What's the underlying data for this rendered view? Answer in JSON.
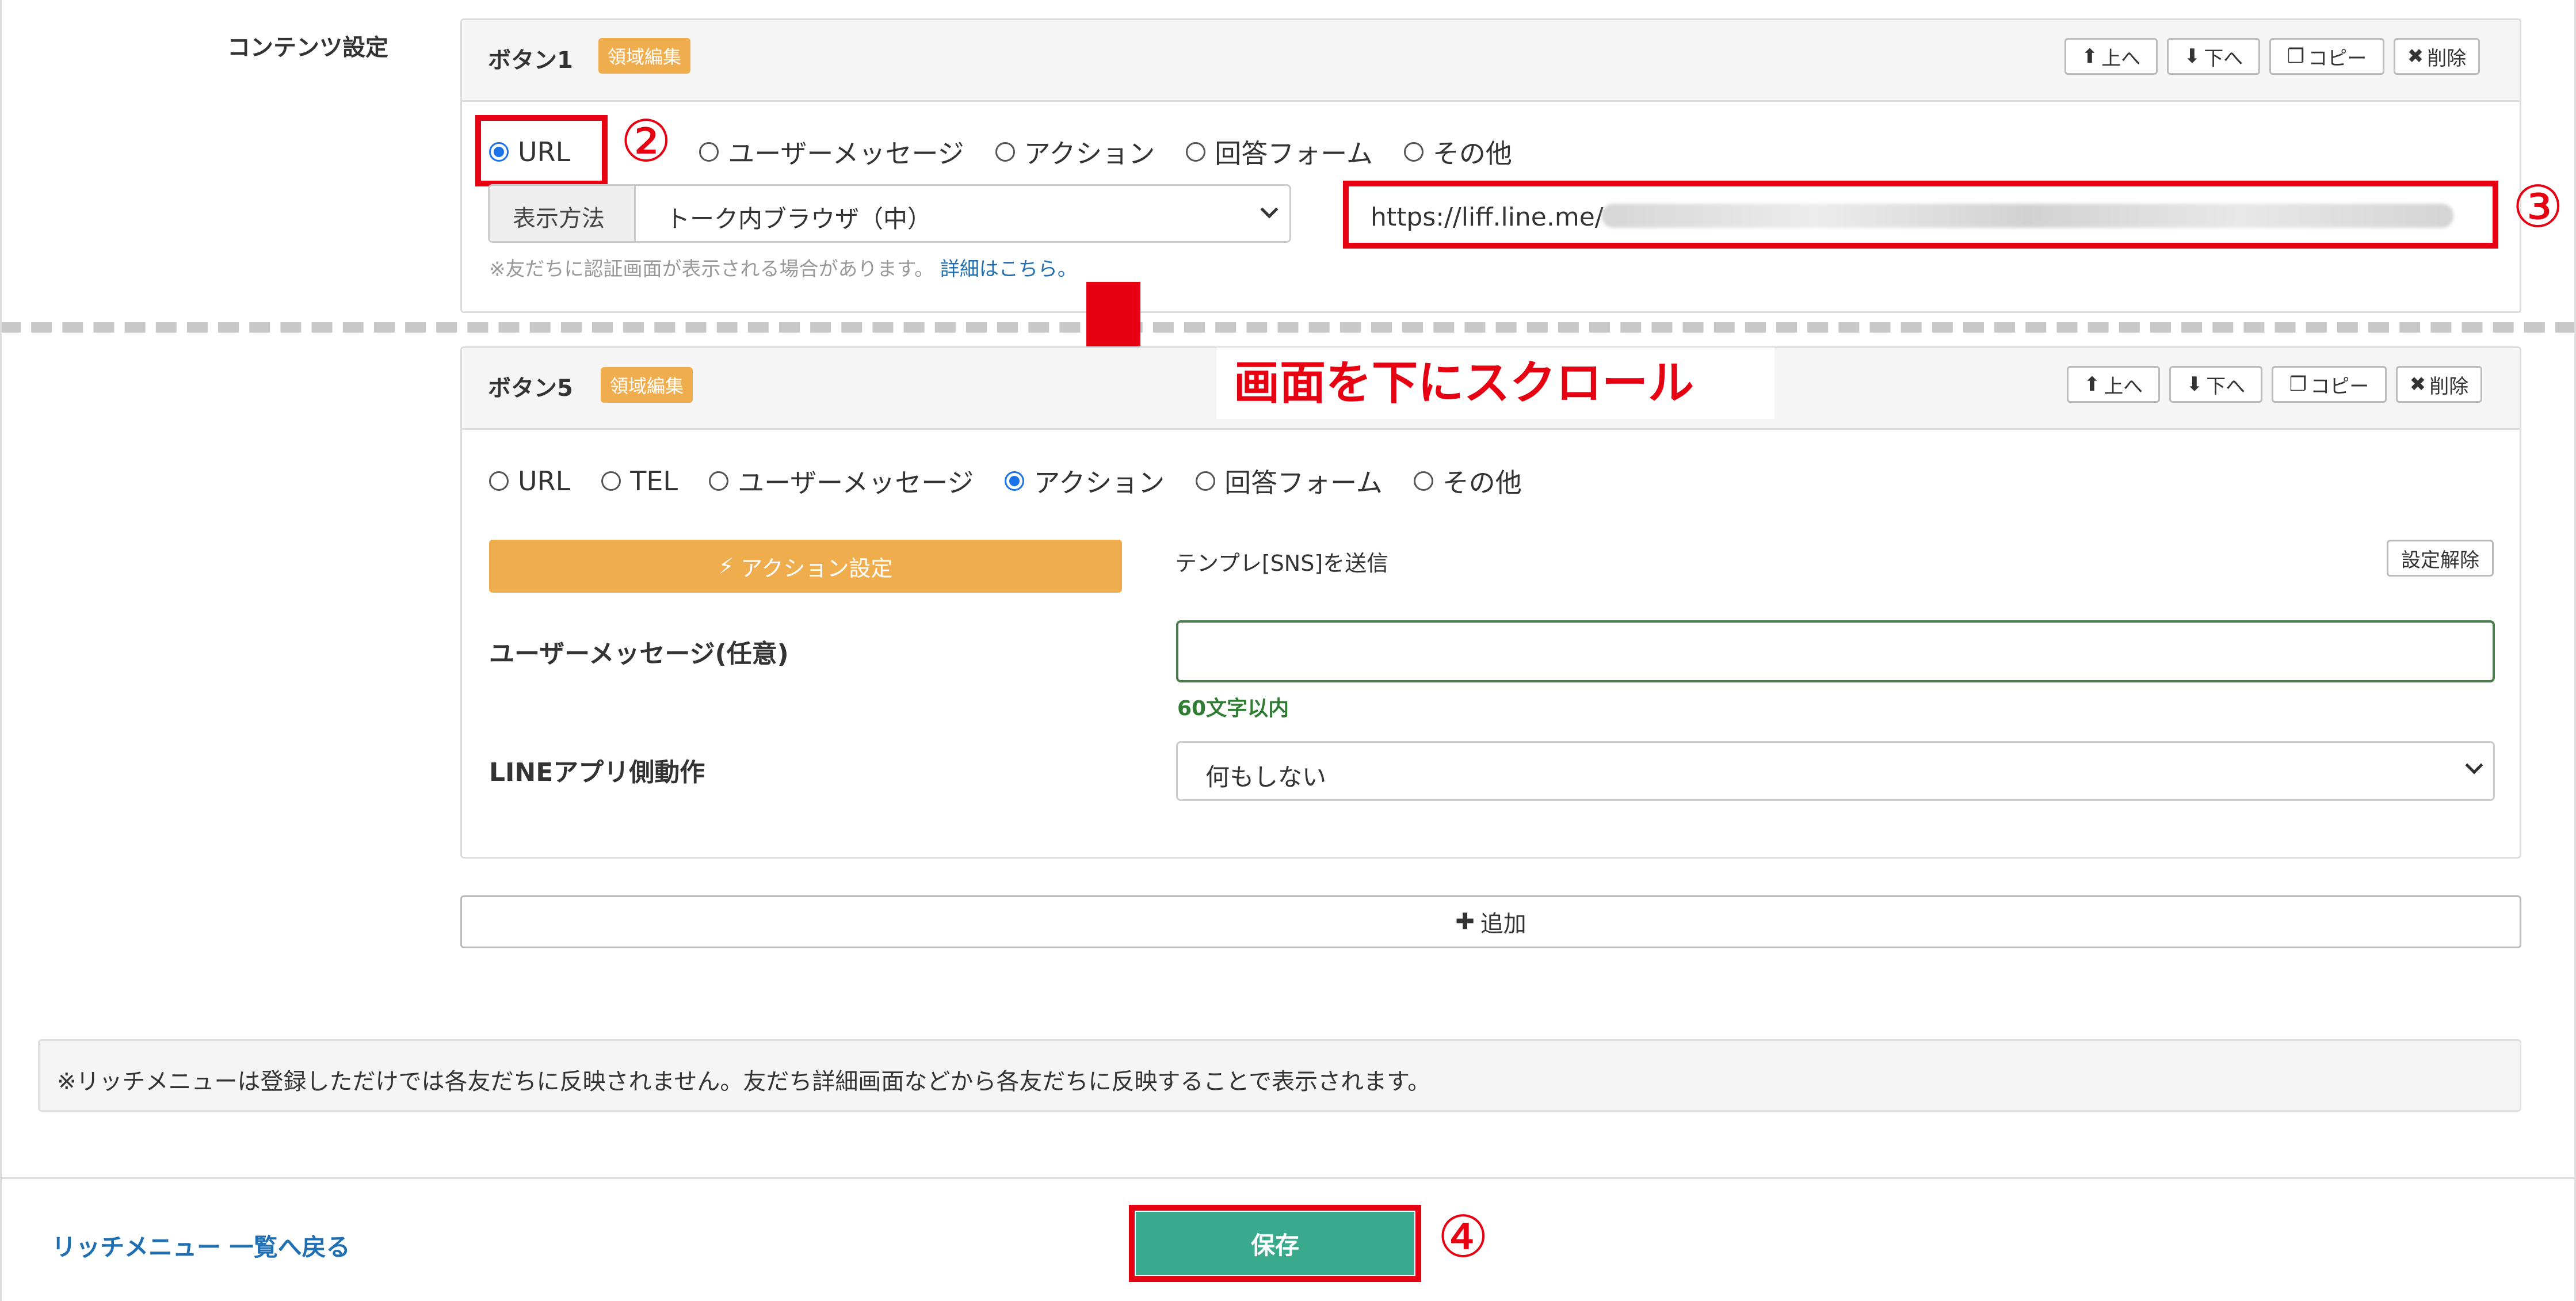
{
  "section_label": "コンテンツ設定",
  "toolbar": {
    "up": "上へ",
    "down": "下へ",
    "copy": "コピー",
    "delete": "削除"
  },
  "button1": {
    "title": "ボタン1",
    "badge": "領域編集",
    "options": [
      "URL",
      "ユーザーメッセージ",
      "アクション",
      "回答フォーム",
      "その他"
    ],
    "selected": "URL",
    "display_label": "表示方法",
    "display_value": "トーク内ブラウザ（中）",
    "url_value": "https://liff.line.me/",
    "note": "※友だちに認証画面が表示される場合があります。",
    "note_link": "詳細はこちら。"
  },
  "banner": "画面を下にスクロール",
  "button5": {
    "title": "ボタン5",
    "badge": "領域編集",
    "options": [
      "URL",
      "TEL",
      "ユーザーメッセージ",
      "アクション",
      "回答フォーム",
      "その他"
    ],
    "selected": "アクション",
    "action_button": "アクション設定",
    "template_text": "テンプレ[SNS]を送信",
    "clear_button": "設定解除",
    "user_message_label": "ユーザーメッセージ(任意)",
    "user_message_value": "",
    "char_limit": "60文字以内",
    "line_action_label": "LINEアプリ側動作",
    "line_action_value": "何もしない"
  },
  "add_button": "追加",
  "notice": "※リッチメニューは登録しただけでは各友だちに反映されません。友だち詳細画面などから各友だちに反映することで表示されます。",
  "back_link": "リッチメニュー 一覧へ戻る",
  "save_button": "保存",
  "annotations": [
    "②",
    "③",
    "④"
  ],
  "colors": {
    "accent_orange": "#f0ad4e",
    "save_green": "#3aaa8c",
    "highlight_red": "#e60012",
    "link_blue": "#1f6fb2",
    "radio_blue": "#1a73e8"
  }
}
